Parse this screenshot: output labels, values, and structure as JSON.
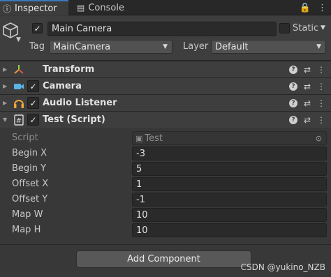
{
  "tabs": {
    "inspector": "Inspector",
    "console": "Console",
    "lock": "🔒",
    "menu": "⋮"
  },
  "object": {
    "active_check": "✓",
    "name": "Main Camera",
    "static_label": "Static",
    "tag_label": "Tag",
    "tag_value": "MainCamera",
    "layer_label": "Layer",
    "layer_value": "Default"
  },
  "components": [
    {
      "title": "Transform",
      "icon": "transform-icon",
      "checked": false
    },
    {
      "title": "Camera",
      "icon": "camera-icon",
      "checked": true
    },
    {
      "title": "Audio Listener",
      "icon": "headphones-icon",
      "checked": true
    },
    {
      "title": "Test (Script)",
      "icon": "script-icon",
      "checked": true
    }
  ],
  "component_tools": {
    "help": "?",
    "settings": "⇄",
    "more": "⋮"
  },
  "script": {
    "label": "Script",
    "value": "Test",
    "properties": [
      {
        "label": "Begin X",
        "value": "-3"
      },
      {
        "label": "Begin Y",
        "value": "5"
      },
      {
        "label": "Offset X",
        "value": "1"
      },
      {
        "label": "Offset Y",
        "value": "-1"
      },
      {
        "label": "Map W",
        "value": "10"
      },
      {
        "label": "Map H",
        "value": "10"
      }
    ]
  },
  "add_component": "Add Component",
  "watermark": "CSDN @yukino_NZB",
  "colors": {
    "accent": "#3a79bb",
    "panel": "#3e3e3e",
    "background": "#383838",
    "field": "#2a2a2a"
  }
}
